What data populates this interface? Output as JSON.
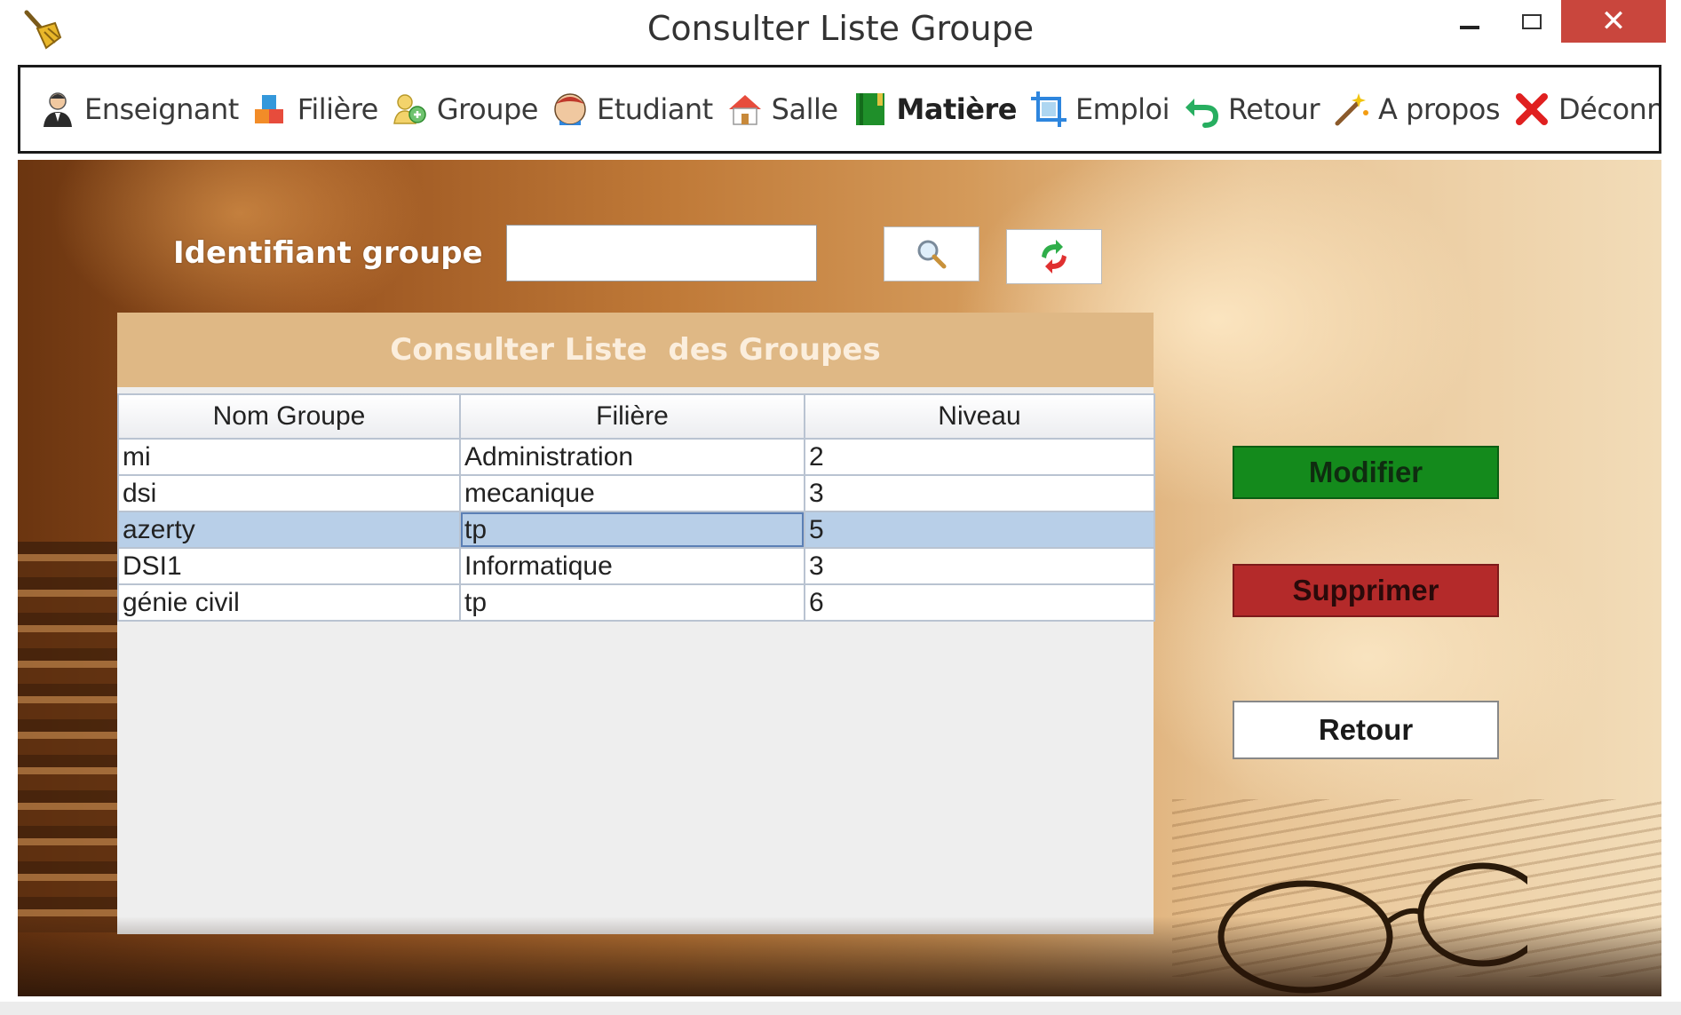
{
  "window": {
    "title": "Consulter Liste Groupe",
    "close_glyph": "✕"
  },
  "toolbar": {
    "items": [
      {
        "label": "Enseignant",
        "icon": "teacher-icon"
      },
      {
        "label": "Filière",
        "icon": "blocks-icon"
      },
      {
        "label": "Groupe",
        "icon": "users-icon"
      },
      {
        "label": "Etudiant",
        "icon": "student-icon"
      },
      {
        "label": "Salle",
        "icon": "house-icon"
      },
      {
        "label": "Matière",
        "icon": "book-icon"
      },
      {
        "label": "Emploi",
        "icon": "crop-icon"
      },
      {
        "label": "Retour",
        "icon": "undo-arrow-icon"
      },
      {
        "label": "A propos",
        "icon": "magic-wand-icon"
      },
      {
        "label": "Déconnexion",
        "icon": "red-x-icon"
      }
    ]
  },
  "search": {
    "label": "Identifiant groupe",
    "value": ""
  },
  "panel": {
    "title": "Consulter Liste  des Groupes"
  },
  "table": {
    "columns": [
      "Nom Groupe",
      "Filière",
      "Niveau"
    ],
    "rows": [
      [
        "mi",
        "Administration",
        "2"
      ],
      [
        "dsi",
        "mecanique",
        "3"
      ],
      [
        "azerty",
        "tp",
        "5"
      ],
      [
        "DSI1",
        "Informatique",
        "3"
      ],
      [
        "génie civil",
        "tp",
        "6"
      ]
    ],
    "selected_row": 2
  },
  "actions": {
    "modifier": "Modifier",
    "supprimer": "Supprimer",
    "retour": "Retour"
  },
  "colors": {
    "modifier_bg": "#148a1c",
    "supprimer_bg": "#b42a2a",
    "panel_header_bg": "#dfb885",
    "selection_bg": "#b8cfe8"
  }
}
